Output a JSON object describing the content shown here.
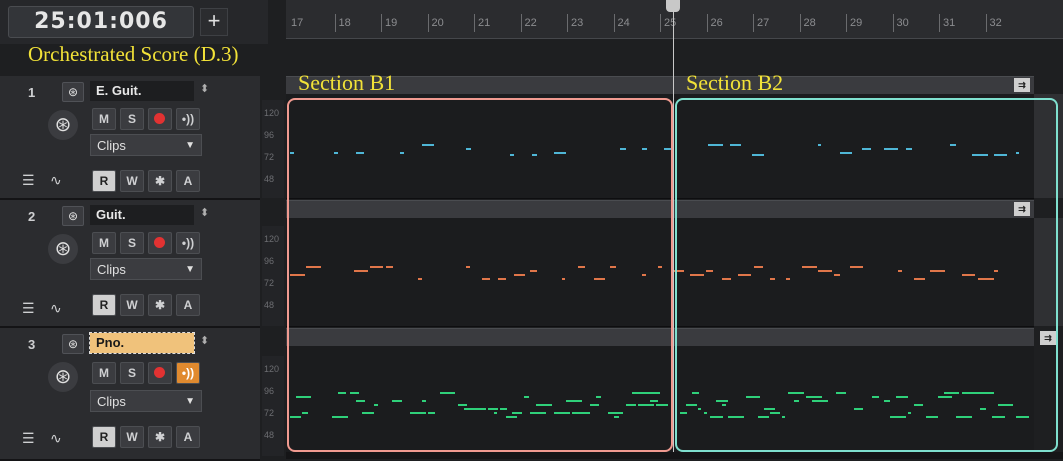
{
  "transport": {
    "time": "25:01:006",
    "add_label": "+"
  },
  "score_title": "Orchestrated Score (D.3)",
  "ruler": {
    "bars": [
      "17",
      "18",
      "19",
      "20",
      "21",
      "22",
      "23",
      "24",
      "25",
      "26",
      "27",
      "28",
      "29",
      "30",
      "31",
      "32"
    ]
  },
  "sections": [
    {
      "label": "Section B1",
      "color": "#f09a90"
    },
    {
      "label": "Section B2",
      "color": "#7fe0cf"
    }
  ],
  "tracks": [
    {
      "number": "1",
      "name": "E. Guit.",
      "selected": false,
      "note_color": "#4fb6d6",
      "buttons": {
        "mute": "M",
        "solo": "S",
        "read": "R",
        "write": "W",
        "star": "✱",
        "auto": "A"
      },
      "clips_label": "Clips",
      "scale": [
        "120",
        "96",
        "72",
        "48"
      ]
    },
    {
      "number": "2",
      "name": "Guit.",
      "selected": false,
      "note_color": "#e0764a",
      "buttons": {
        "mute": "M",
        "solo": "S",
        "read": "R",
        "write": "W",
        "star": "✱",
        "auto": "A"
      },
      "clips_label": "Clips",
      "scale": [
        "120",
        "96",
        "72",
        "48"
      ]
    },
    {
      "number": "3",
      "name": "Pno.",
      "selected": true,
      "note_color": "#2fd07a",
      "buttons": {
        "mute": "M",
        "solo": "S",
        "read": "R",
        "write": "W",
        "star": "✱",
        "auto": "A"
      },
      "clips_label": "Clips",
      "scale": [
        "120",
        "96",
        "72",
        "48"
      ]
    }
  ],
  "colors": {
    "accent_title": "#f2e238",
    "record": "#e23232",
    "input_echo_active": "#e08a2f"
  }
}
